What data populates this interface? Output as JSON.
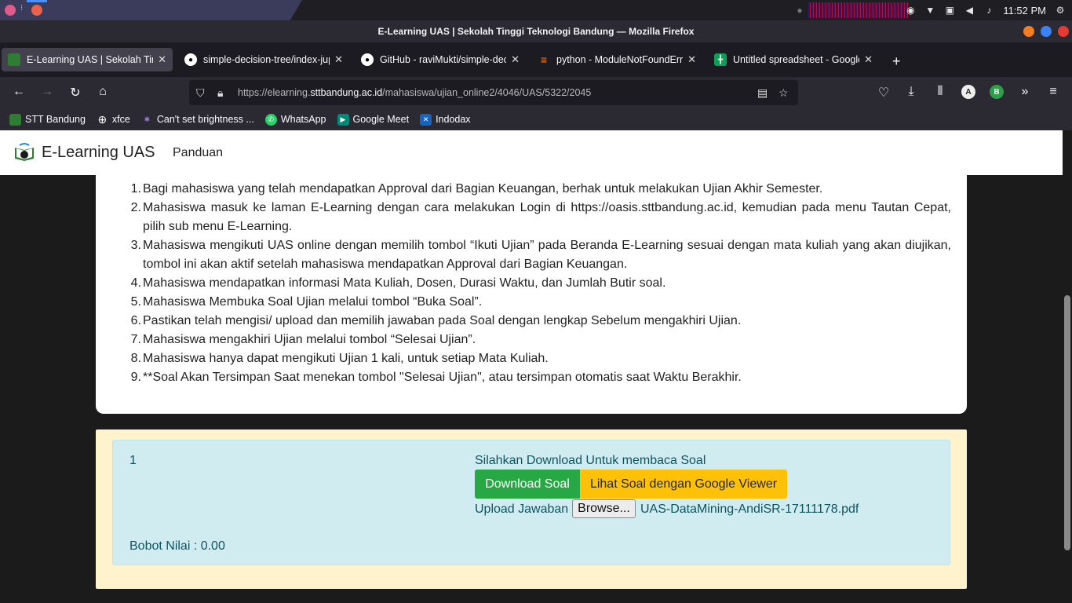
{
  "system": {
    "clock": "11:52 PM"
  },
  "window": {
    "title": "E-Learning UAS | Sekolah Tinggi Teknologi Bandung — Mozilla Firefox"
  },
  "tabs": [
    {
      "title": "E-Learning UAS | Sekolah Tinggi Teknologi Bandung",
      "icon": "elearning-icon",
      "active": true
    },
    {
      "title": "simple-decision-tree/index-jupyter",
      "icon": "github-icon"
    },
    {
      "title": "GitHub - raviMukti/simple-decision-tree",
      "icon": "github-icon"
    },
    {
      "title": "python - ModuleNotFoundError",
      "icon": "stackoverflow-icon"
    },
    {
      "title": "Untitled spreadsheet - Google Sheets",
      "icon": "sheets-icon"
    }
  ],
  "url": {
    "prefix": "https://elearning.",
    "host": "sttbandung.ac.id",
    "path": "/mahasiswa/ujian_online2/4046/UAS/5322/2045"
  },
  "bookmarks": [
    {
      "label": "STT Bandung",
      "icon": "stt-icon",
      "color": "#2e7d32"
    },
    {
      "label": "xfce",
      "icon": "globe-icon",
      "color": "#555555"
    },
    {
      "label": "Can't set brightness ...",
      "icon": "ubuntu-icon",
      "color": "#7a4b9a"
    },
    {
      "label": "WhatsApp",
      "icon": "whatsapp-icon",
      "color": "#25d366"
    },
    {
      "label": "Google Meet",
      "icon": "meet-icon",
      "color": "#00897b"
    },
    {
      "label": "Indodax",
      "icon": "indodax-icon",
      "color": "#1565c0"
    }
  ],
  "site": {
    "brand": "E-Learning UAS",
    "nav_link": "Panduan"
  },
  "rules": [
    "Bagi mahasiswa yang telah mendapatkan Approval dari Bagian Keuangan, berhak untuk melakukan Ujian Akhir Semester.",
    "Mahasiswa masuk ke laman E-Learning dengan cara melakukan Login di https://oasis.sttbandung.ac.id, kemudian pada menu Tautan Cepat, pilih sub menu E-Learning.",
    "Mahasiswa mengikuti UAS online dengan memilih tombol “Ikuti Ujian” pada Beranda E-Learning sesuai dengan mata kuliah yang akan diujikan, tombol ini akan aktif setelah mahasiswa mendapatkan Approval dari Bagian Keuangan.",
    "Mahasiswa mendapatkan informasi Mata Kuliah, Dosen, Durasi Waktu, dan Jumlah Butir soal.",
    "Mahasiswa Membuka Soal Ujian melalui tombol “Buka Soal”.",
    "Pastikan telah mengisi/ upload dan memilih jawaban pada Soal dengan lengkap Sebelum mengakhiri Ujian.",
    "Mahasiswa mengakhiri Ujian melalui tombol “Selesai Ujian”.",
    "Mahasiswa hanya dapat mengikuti Ujian 1 kali, untuk setiap Mata Kuliah.",
    "**Soal Akan Tersimpan Saat menekan tombol \"Selesai Ujian\", atau tersimpan otomatis saat Waktu Berakhir."
  ],
  "question": {
    "number": "1",
    "message": "Silahkan Download Untuk membaca Soal",
    "download_label": "Download Soal",
    "viewer_label": "Lihat Soal dengan Google Viewer",
    "upload_label": "Upload Jawaban",
    "browse_label": "Browse...",
    "file_name": "UAS-DataMining-AndiSR-17111178.pdf",
    "bobot": "Bobot Nilai : 0.00"
  }
}
